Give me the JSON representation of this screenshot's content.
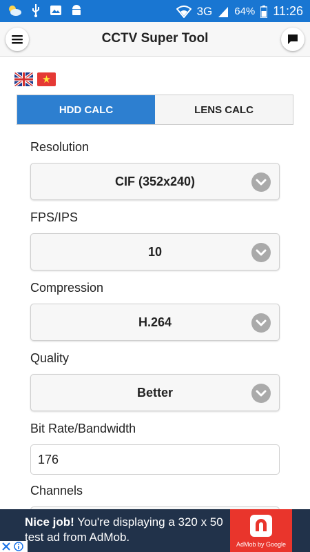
{
  "status_bar": {
    "network": "3G",
    "battery": "64%",
    "time": "11:26"
  },
  "app_bar": {
    "title": "CCTV Super Tool"
  },
  "languages": [
    "english-flag",
    "vietnamese-flag"
  ],
  "tabs": [
    {
      "label": "HDD CALC",
      "active": true
    },
    {
      "label": "LENS CALC",
      "active": false
    }
  ],
  "form": {
    "resolution_label": "Resolution",
    "resolution_value": "CIF (352x240)",
    "fps_label": "FPS/IPS",
    "fps_value": "10",
    "compression_label": "Compression",
    "compression_value": "H.264",
    "quality_label": "Quality",
    "quality_value": "Better",
    "bitrate_label": "Bit Rate/Bandwidth",
    "bitrate_value": "176",
    "channels_label": "Channels"
  },
  "ad": {
    "headline": "Nice job!",
    "body": "You're displaying a 320 x 50 test ad from AdMob.",
    "brand": "AdMob by Google"
  },
  "colors": {
    "status_bar": "#1976d2",
    "active_tab": "#2d7fd0",
    "ad_background": "#21324a",
    "ad_logo": "#e9352c"
  }
}
